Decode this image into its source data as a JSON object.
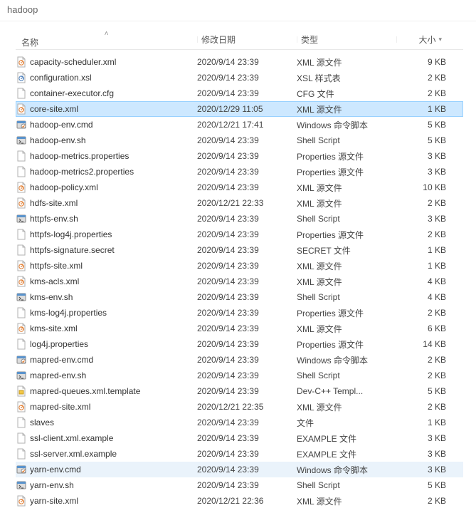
{
  "breadcrumb": "hadoop",
  "columns": {
    "name": "名称",
    "date": "修改日期",
    "type": "类型",
    "size": "大小"
  },
  "icons": {
    "xml": "xml-file-icon",
    "xsl": "xsl-file-icon",
    "cfg": "file-icon",
    "cmd": "cmd-file-icon",
    "sh": "sh-file-icon",
    "properties": "file-icon",
    "secret": "file-icon",
    "template": "template-file-icon",
    "plain": "file-icon",
    "example": "file-icon"
  },
  "files": [
    {
      "name": "capacity-scheduler.xml",
      "date": "2020/9/14 23:39",
      "type": "XML 源文件",
      "size": "9 KB",
      "icon": "xml"
    },
    {
      "name": "configuration.xsl",
      "date": "2020/9/14 23:39",
      "type": "XSL 样式表",
      "size": "2 KB",
      "icon": "xsl"
    },
    {
      "name": "container-executor.cfg",
      "date": "2020/9/14 23:39",
      "type": "CFG 文件",
      "size": "2 KB",
      "icon": "cfg"
    },
    {
      "name": "core-site.xml",
      "date": "2020/12/29 11:05",
      "type": "XML 源文件",
      "size": "1 KB",
      "icon": "xml",
      "state": "selected"
    },
    {
      "name": "hadoop-env.cmd",
      "date": "2020/12/21 17:41",
      "type": "Windows 命令脚本",
      "size": "5 KB",
      "icon": "cmd"
    },
    {
      "name": "hadoop-env.sh",
      "date": "2020/9/14 23:39",
      "type": "Shell Script",
      "size": "5 KB",
      "icon": "sh"
    },
    {
      "name": "hadoop-metrics.properties",
      "date": "2020/9/14 23:39",
      "type": "Properties 源文件",
      "size": "3 KB",
      "icon": "properties"
    },
    {
      "name": "hadoop-metrics2.properties",
      "date": "2020/9/14 23:39",
      "type": "Properties 源文件",
      "size": "3 KB",
      "icon": "properties"
    },
    {
      "name": "hadoop-policy.xml",
      "date": "2020/9/14 23:39",
      "type": "XML 源文件",
      "size": "10 KB",
      "icon": "xml"
    },
    {
      "name": "hdfs-site.xml",
      "date": "2020/12/21 22:33",
      "type": "XML 源文件",
      "size": "2 KB",
      "icon": "xml"
    },
    {
      "name": "httpfs-env.sh",
      "date": "2020/9/14 23:39",
      "type": "Shell Script",
      "size": "3 KB",
      "icon": "sh"
    },
    {
      "name": "httpfs-log4j.properties",
      "date": "2020/9/14 23:39",
      "type": "Properties 源文件",
      "size": "2 KB",
      "icon": "properties"
    },
    {
      "name": "httpfs-signature.secret",
      "date": "2020/9/14 23:39",
      "type": "SECRET 文件",
      "size": "1 KB",
      "icon": "secret"
    },
    {
      "name": "httpfs-site.xml",
      "date": "2020/9/14 23:39",
      "type": "XML 源文件",
      "size": "1 KB",
      "icon": "xml"
    },
    {
      "name": "kms-acls.xml",
      "date": "2020/9/14 23:39",
      "type": "XML 源文件",
      "size": "4 KB",
      "icon": "xml"
    },
    {
      "name": "kms-env.sh",
      "date": "2020/9/14 23:39",
      "type": "Shell Script",
      "size": "4 KB",
      "icon": "sh"
    },
    {
      "name": "kms-log4j.properties",
      "date": "2020/9/14 23:39",
      "type": "Properties 源文件",
      "size": "2 KB",
      "icon": "properties"
    },
    {
      "name": "kms-site.xml",
      "date": "2020/9/14 23:39",
      "type": "XML 源文件",
      "size": "6 KB",
      "icon": "xml"
    },
    {
      "name": "log4j.properties",
      "date": "2020/9/14 23:39",
      "type": "Properties 源文件",
      "size": "14 KB",
      "icon": "properties"
    },
    {
      "name": "mapred-env.cmd",
      "date": "2020/9/14 23:39",
      "type": "Windows 命令脚本",
      "size": "2 KB",
      "icon": "cmd"
    },
    {
      "name": "mapred-env.sh",
      "date": "2020/9/14 23:39",
      "type": "Shell Script",
      "size": "2 KB",
      "icon": "sh"
    },
    {
      "name": "mapred-queues.xml.template",
      "date": "2020/9/14 23:39",
      "type": "Dev-C++ Templ...",
      "size": "5 KB",
      "icon": "template"
    },
    {
      "name": "mapred-site.xml",
      "date": "2020/12/21 22:35",
      "type": "XML 源文件",
      "size": "2 KB",
      "icon": "xml"
    },
    {
      "name": "slaves",
      "date": "2020/9/14 23:39",
      "type": "文件",
      "size": "1 KB",
      "icon": "plain"
    },
    {
      "name": "ssl-client.xml.example",
      "date": "2020/9/14 23:39",
      "type": "EXAMPLE 文件",
      "size": "3 KB",
      "icon": "example"
    },
    {
      "name": "ssl-server.xml.example",
      "date": "2020/9/14 23:39",
      "type": "EXAMPLE 文件",
      "size": "3 KB",
      "icon": "example"
    },
    {
      "name": "yarn-env.cmd",
      "date": "2020/9/14 23:39",
      "type": "Windows 命令脚本",
      "size": "3 KB",
      "icon": "cmd",
      "state": "hover"
    },
    {
      "name": "yarn-env.sh",
      "date": "2020/9/14 23:39",
      "type": "Shell Script",
      "size": "5 KB",
      "icon": "sh"
    },
    {
      "name": "yarn-site.xml",
      "date": "2020/12/21 22:36",
      "type": "XML 源文件",
      "size": "2 KB",
      "icon": "xml"
    }
  ]
}
